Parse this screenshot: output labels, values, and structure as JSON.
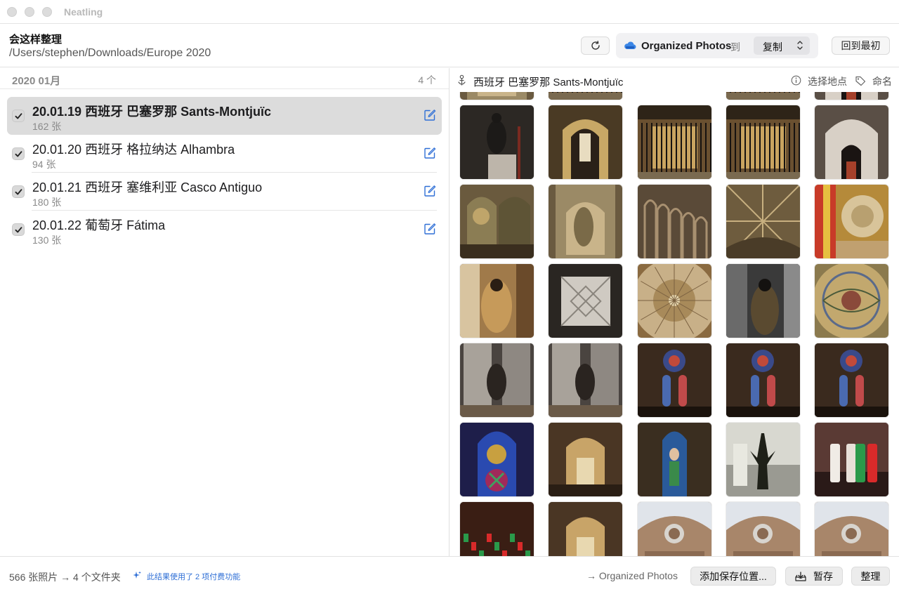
{
  "window": {
    "title": "Neatling"
  },
  "toolbar": {
    "heading": "会这样整理",
    "source_path": "/Users/stephen/Downloads/Europe 2020",
    "destination": "Organized Photos",
    "to_label": "到",
    "mode": "复制",
    "reset_label": "回到最初",
    "refresh_icon": "refresh-icon",
    "cloud_icon": "cloud-drive-icon"
  },
  "left": {
    "section_title": "2020 01月",
    "section_count": "4 个",
    "folders": [
      {
        "name": "20.01.19 西班牙 巴塞罗那 Sants-Montjuïc",
        "count": "162 张",
        "checked": true,
        "selected": true
      },
      {
        "name": "20.01.20 西班牙 格拉纳达 Alhambra",
        "count": "94 张",
        "checked": true,
        "selected": false
      },
      {
        "name": "20.01.21 西班牙 塞维利亚 Casco Antiguo",
        "count": "180 张",
        "checked": true,
        "selected": false
      },
      {
        "name": "20.01.22 葡萄牙 Fátima",
        "count": "130 张",
        "checked": true,
        "selected": false
      }
    ]
  },
  "right": {
    "title": "西班牙 巴塞罗那 Sants-Montjuïc",
    "choose_place": "选择地点",
    "rename": "命名",
    "photos": [
      {
        "style": "statue-dark"
      },
      {
        "style": "altar-gold"
      },
      {
        "style": "chapel-gate"
      },
      {
        "style": "chapel-gate"
      },
      {
        "style": "arch-white"
      },
      {
        "style": "chapel-gold"
      },
      {
        "style": "relief-gold"
      },
      {
        "style": "nave-arches"
      },
      {
        "style": "vault-ceiling"
      },
      {
        "style": "flag-mosaic"
      },
      {
        "style": "madonna-gold"
      },
      {
        "style": "stone-tile"
      },
      {
        "style": "dome-painted"
      },
      {
        "style": "madonna-dark"
      },
      {
        "style": "mosaic-dome"
      },
      {
        "style": "silver-altar"
      },
      {
        "style": "silver-altar"
      },
      {
        "style": "rose-window"
      },
      {
        "style": "rose-window"
      },
      {
        "style": "rose-window"
      },
      {
        "style": "stained-glass"
      },
      {
        "style": "altar-nave"
      },
      {
        "style": "stained-figure"
      },
      {
        "style": "bronze-statue"
      },
      {
        "style": "candles-bright"
      },
      {
        "style": "candles-red"
      },
      {
        "style": "altar-nave"
      },
      {
        "style": "facade"
      },
      {
        "style": "facade"
      },
      {
        "style": "facade"
      }
    ]
  },
  "footer": {
    "stats": "566 张照片 → 4 个文件夹",
    "paid_note": "此结果使用了 2 项付费功能",
    "dest_summary": "→ Organized Photos",
    "add_location": "添加保存位置...",
    "save": "暂存",
    "organize": "整理"
  },
  "colors": {
    "accent": "#2f6fd6",
    "selected_row": "#dcdcdc"
  }
}
